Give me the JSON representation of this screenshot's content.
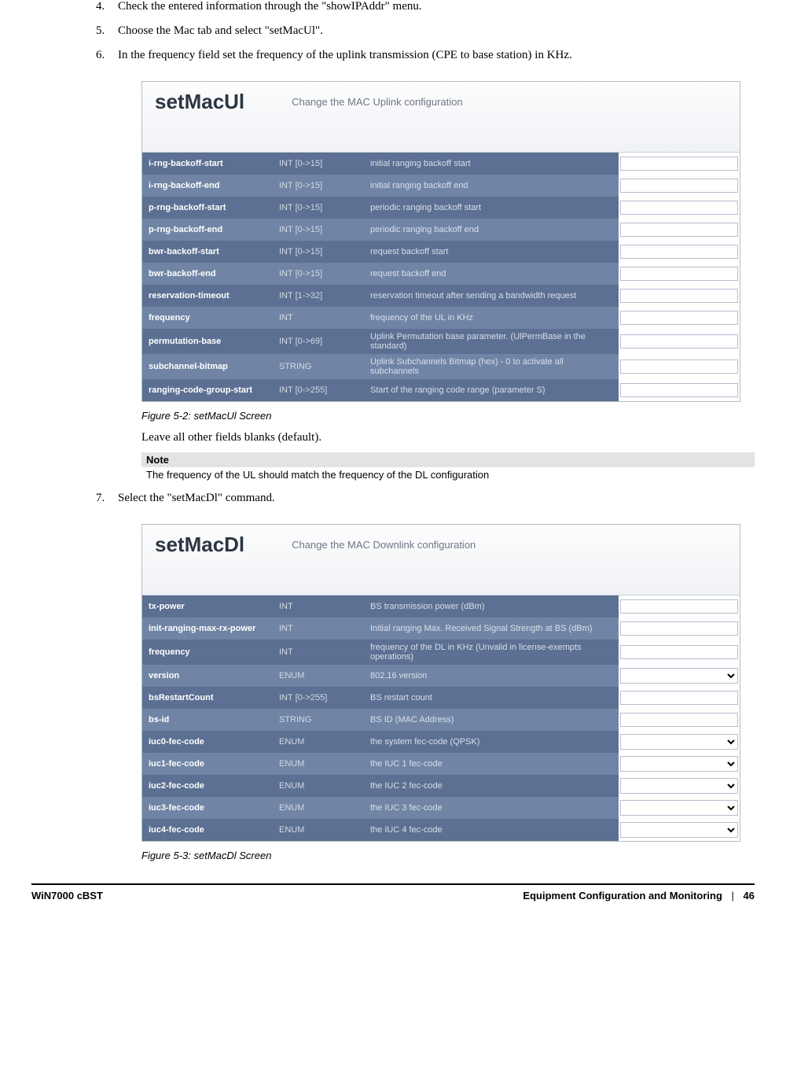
{
  "steps": {
    "s4": "Check the entered information through the \"showIPAddr\" menu.",
    "s5": "Choose the Mac tab and select \"setMacUl\".",
    "s6": "In the frequency field set the frequency of the uplink transmission (CPE to base station) in KHz.",
    "s7": "Select the \"setMacDl\" command."
  },
  "fig1": {
    "title": "setMacUl",
    "subtitle": "Change the MAC Uplink configuration",
    "caption": "Figure 5-2: setMacUl Screen",
    "rows": [
      {
        "name": "i-rng-backoff-start",
        "type": "INT [0->15]",
        "desc": "initial ranging backoff start",
        "field": "text"
      },
      {
        "name": "i-rng-backoff-end",
        "type": "INT [0->15]",
        "desc": "initial ranging backoff end",
        "field": "text"
      },
      {
        "name": "p-rng-backoff-start",
        "type": "INT [0->15]",
        "desc": "periodic ranging backoff start",
        "field": "text"
      },
      {
        "name": "p-rng-backoff-end",
        "type": "INT [0->15]",
        "desc": "periodic ranging backoff end",
        "field": "text"
      },
      {
        "name": "bwr-backoff-start",
        "type": "INT [0->15]",
        "desc": "request backoff start",
        "field": "text"
      },
      {
        "name": "bwr-backoff-end",
        "type": "INT [0->15]",
        "desc": "request backoff end",
        "field": "text"
      },
      {
        "name": "reservation-timeout",
        "type": "INT [1->32]",
        "desc": "reservation timeout after sending a bandwidth request",
        "field": "text"
      },
      {
        "name": "frequency",
        "type": "INT",
        "desc": "frequency of the UL in KHz",
        "field": "text"
      },
      {
        "name": "permutation-base",
        "type": "INT [0->69]",
        "desc": "Uplink Permutation base parameter. (UlPermBase in the standard)",
        "field": "text"
      },
      {
        "name": "subchannel-bitmap",
        "type": "STRING",
        "desc": "Uplink Subchannels Bitmap (hex) - 0 to activate all subchannels",
        "field": "text"
      },
      {
        "name": "ranging-code-group-start",
        "type": "INT [0->255]",
        "desc": "Start of the ranging code range (parameter S)",
        "field": "text"
      }
    ]
  },
  "post_fig1": "Leave all other fields blanks (default).",
  "note": {
    "label": "Note",
    "body": "The frequency of the UL should match the frequency of the DL configuration"
  },
  "fig2": {
    "title": "setMacDl",
    "subtitle": "Change the MAC Downlink configuration",
    "caption": "Figure 5-3: setMacDl Screen",
    "rows": [
      {
        "name": "tx-power",
        "type": "INT",
        "desc": "BS transmission power (dBm)",
        "field": "text"
      },
      {
        "name": "init-ranging-max-rx-power",
        "type": "INT",
        "desc": "Initial ranging Max. Received Signal Strength at BS (dBm)",
        "field": "text"
      },
      {
        "name": "frequency",
        "type": "INT",
        "desc": "frequency of the DL in KHz (Unvalid in license-exempts operations)",
        "field": "text"
      },
      {
        "name": "version",
        "type": "ENUM",
        "desc": "802.16 version",
        "field": "select"
      },
      {
        "name": "bsRestartCount",
        "type": "INT [0->255]",
        "desc": "BS restart count",
        "field": "text"
      },
      {
        "name": "bs-id",
        "type": "STRING",
        "desc": "BS ID (MAC Address)",
        "field": "text"
      },
      {
        "name": "iuc0-fec-code",
        "type": "ENUM",
        "desc": "the system fec-code (QPSK)",
        "field": "select"
      },
      {
        "name": "iuc1-fec-code",
        "type": "ENUM",
        "desc": "the IUC 1 fec-code",
        "field": "select"
      },
      {
        "name": "iuc2-fec-code",
        "type": "ENUM",
        "desc": "the IUC 2 fec-code",
        "field": "select"
      },
      {
        "name": "iuc3-fec-code",
        "type": "ENUM",
        "desc": "the IUC 3 fec-code",
        "field": "select"
      },
      {
        "name": "iuc4-fec-code",
        "type": "ENUM",
        "desc": "the IUC 4 fec-code",
        "field": "select"
      }
    ]
  },
  "footer": {
    "left": "WiN7000 cBST",
    "right_title": "Equipment Configuration and Monitoring",
    "page": "46"
  }
}
